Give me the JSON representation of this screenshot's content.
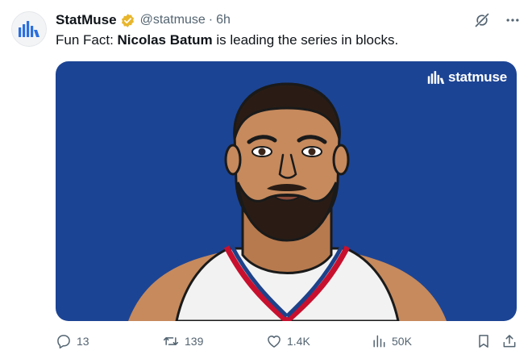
{
  "account": {
    "display_name": "StatMuse",
    "handle": "@statmuse",
    "separator": "·",
    "time": "6h",
    "verified": true
  },
  "tweet": {
    "prefix": "Fun Fact: ",
    "bold_name": "Nicolas Batum",
    "suffix": " is leading the series in blocks."
  },
  "media": {
    "watermark": "statmuse",
    "background_color": "#1c4494"
  },
  "actions": {
    "replies": "13",
    "retweets": "139",
    "likes": "1.4K",
    "views": "50K"
  },
  "icons": [
    "statmuse-logo-icon",
    "verified-badge-icon",
    "grok-icon",
    "more-icon",
    "reply-icon",
    "retweet-icon",
    "like-icon",
    "views-icon",
    "bookmark-icon",
    "share-icon"
  ]
}
